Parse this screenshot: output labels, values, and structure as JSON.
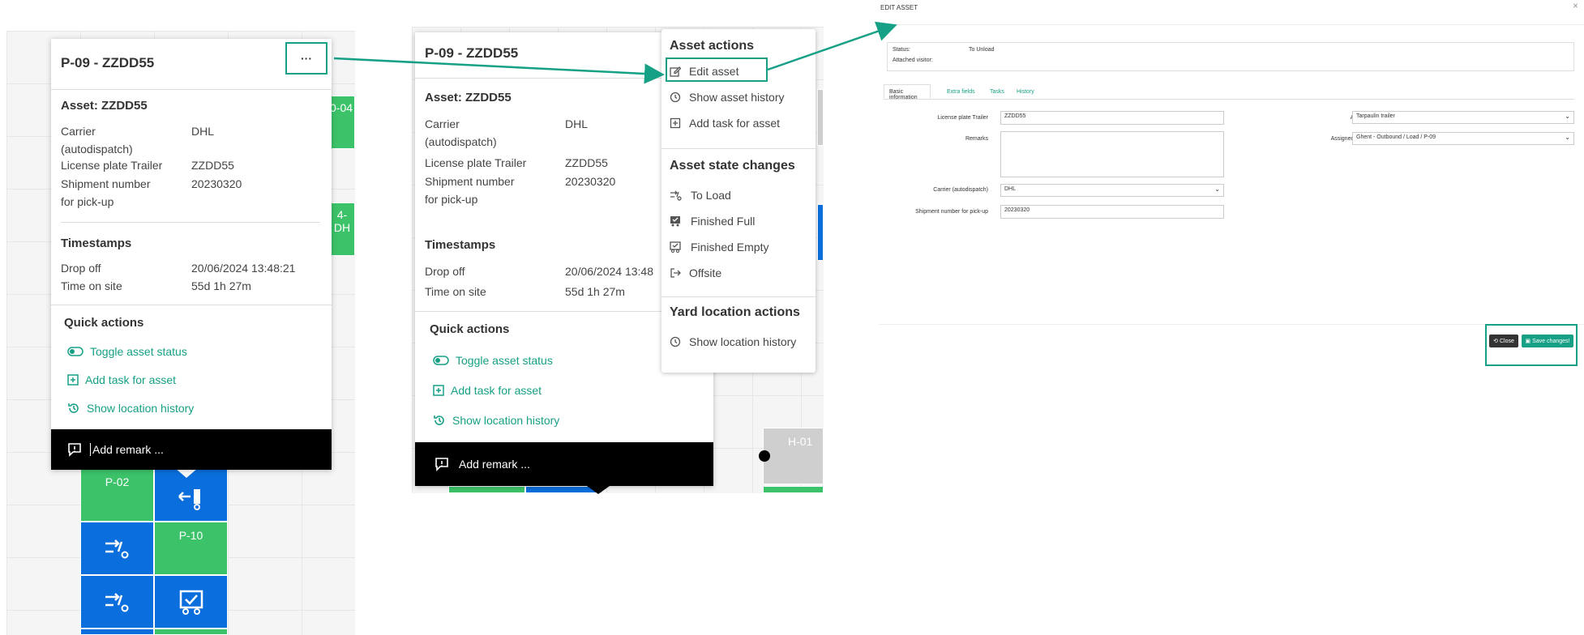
{
  "panel1": {
    "card_title": "P-09 - ZZDD55",
    "more_label": "···",
    "asset_heading": "Asset: ZZDD55",
    "details": [
      {
        "label": "Carrier\n(autodispatch)",
        "value": "DHL"
      },
      {
        "label": "License plate Trailer",
        "value": "ZZDD55"
      },
      {
        "label": "Shipment number\nfor pick-up",
        "value": "20230320"
      }
    ],
    "timestamps_heading": "Timestamps",
    "timestamps": [
      {
        "label": "Drop off",
        "value": "20/06/2024 13:48:21"
      },
      {
        "label": "Time on site",
        "value": "55d 1h 27m"
      }
    ],
    "quick_actions_heading": "Quick actions",
    "quick_actions": [
      "Toggle asset status",
      "Add task for asset",
      "Show location history"
    ],
    "remark_placeholder": "Add remark ...",
    "grid_labels": {
      "p02": "P-02",
      "p10": "P-10",
      "o04": "0-04",
      "dh": "4-DH"
    }
  },
  "panel2": {
    "card_title": "P-09 - ZZDD55",
    "asset_heading": "Asset: ZZDD55",
    "details": [
      {
        "label": "Carrier\n(autodispatch)",
        "value": "DHL"
      },
      {
        "label": "License plate Trailer",
        "value": "ZZDD55"
      },
      {
        "label": "Shipment number\nfor pick-up",
        "value": "20230320"
      }
    ],
    "timestamps_heading": "Timestamps",
    "timestamps": [
      {
        "label": "Drop off",
        "value": "20/06/2024 13:48"
      },
      {
        "label": "Time on site",
        "value": "55d 1h 27m"
      }
    ],
    "quick_actions_heading": "Quick actions",
    "quick_actions": [
      "Toggle asset status",
      "Add task for asset",
      "Show location history"
    ],
    "remark_placeholder": "Add remark ...",
    "grid_labels": {
      "h01": "H-01"
    },
    "menu": {
      "asset_actions_heading": "Asset actions",
      "asset_actions": [
        "Edit asset",
        "Show asset history",
        "Add task for asset"
      ],
      "state_heading": "Asset state changes",
      "state_changes": [
        "To Load",
        "Finished Full",
        "Finished Empty",
        "Offsite"
      ],
      "yard_heading": "Yard location actions",
      "yard_actions": [
        "Show location history"
      ]
    }
  },
  "panel3": {
    "title": "EDIT ASSET",
    "close_x": "×",
    "status_label": "Status:",
    "status_value": "To Unload",
    "attached_visitor_label": "Attached visitor:",
    "tabs": [
      "Basic information",
      "Extra fields",
      "Tasks",
      "History"
    ],
    "fields": {
      "license_plate_label": "License plate Trailer",
      "license_plate_value": "ZZDD55",
      "remarks_label": "Remarks",
      "carrier_label": "Carrier (autodispatch)",
      "carrier_value": "DHL",
      "shipment_label": "Shipment number for pick-up",
      "shipment_value": "20230320",
      "asset_category_label": "Asset category",
      "asset_category_value": "Tarpaulin trailer",
      "assigned_location_label": "Assigned yard location",
      "assigned_location_value": "Ghent - Outbound / Load / P-09"
    },
    "close_button": "Close",
    "save_button": "Save changes!"
  },
  "colors": {
    "accent": "#16a085",
    "green_slot": "#3cc36a",
    "blue_slot": "#0a6edc",
    "remark_bar": "#000000",
    "highlight_box": "#16a085",
    "close_btn": "#333333",
    "save_btn": "#16a085"
  }
}
